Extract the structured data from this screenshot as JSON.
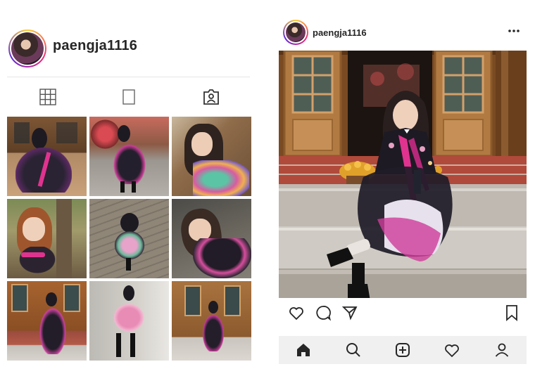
{
  "profile": {
    "username": "paengja1116",
    "tabs": [
      "grid-icon",
      "square-icon",
      "tagged-icon"
    ],
    "grid_count": 9
  },
  "post": {
    "username": "paengja1116",
    "more_icon": "more-icon",
    "actions": [
      "heart-icon",
      "comment-icon",
      "share-icon",
      "bookmark-icon"
    ]
  },
  "bottom_nav": {
    "items": [
      "home-icon",
      "search-icon",
      "add-icon",
      "heart-icon",
      "profile-icon"
    ]
  },
  "colors": {
    "accent_pink": "#e0338f",
    "hanbok_black": "#1c1a24",
    "wood": "#a7632f",
    "stone": "#c9c4bd"
  }
}
